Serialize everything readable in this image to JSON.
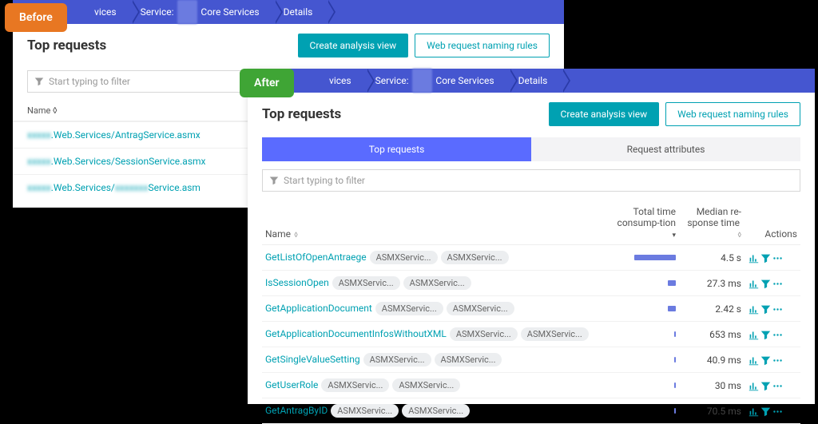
{
  "badges": {
    "before": "Before",
    "after": "After"
  },
  "breadcrumbs": {
    "services": "vices",
    "service_prefix": "Service:",
    "service_name": "Core Services",
    "details": "Details"
  },
  "header": {
    "title": "Top requests",
    "create_btn": "Create analysis view",
    "rules_btn": "Web request naming rules"
  },
  "filter": {
    "placeholder": "Start typing to filter"
  },
  "tabs": {
    "top": "Top requests",
    "attrs": "Request attributes"
  },
  "before_list": {
    "name_col": "Name",
    "rows": [
      {
        "text": ".Web.Services/AntragService.asmx"
      },
      {
        "text": ".Web.Services/SessionService.asmx"
      },
      {
        "text": ".Web.Services/",
        "suffix": "Service.asm"
      }
    ]
  },
  "table": {
    "cols": {
      "name": "Name",
      "total": "Total time consump-tion",
      "median": "Median re-sponse time",
      "actions": "Actions"
    },
    "rows": [
      {
        "name": "GetListOfOpenAntraege",
        "tags": [
          "ASMXServic...",
          "ASMXServic..."
        ],
        "bar": 52,
        "rt": "4.5 s"
      },
      {
        "name": "IsSessionOpen",
        "tags": [
          "ASMXServic...",
          "ASMXServic..."
        ],
        "bar": 10,
        "rt": "27.3 ms"
      },
      {
        "name": "GetApplicationDocument",
        "tags": [
          "ASMXServic...",
          "ASMXServic..."
        ],
        "bar": 10,
        "rt": "2.42 s"
      },
      {
        "name": "GetApplicationDocumentInfosWithoutXML",
        "tags": [
          "ASMXServic...",
          "ASMXServic..."
        ],
        "bar": 2,
        "rt": "653 ms"
      },
      {
        "name": "GetSingleValueSetting",
        "tags": [
          "ASMXServic...",
          "ASMXServic..."
        ],
        "bar": 2,
        "rt": "40.9 ms"
      },
      {
        "name": "GetUserRole",
        "tags": [
          "ASMXServic...",
          "ASMXServic..."
        ],
        "bar": 2,
        "rt": "30 ms"
      },
      {
        "name": "GetAntragByID",
        "tags": [
          "ASMXServic...",
          "ASMXServic..."
        ],
        "bar": 2,
        "rt": "70.5 ms"
      }
    ]
  }
}
